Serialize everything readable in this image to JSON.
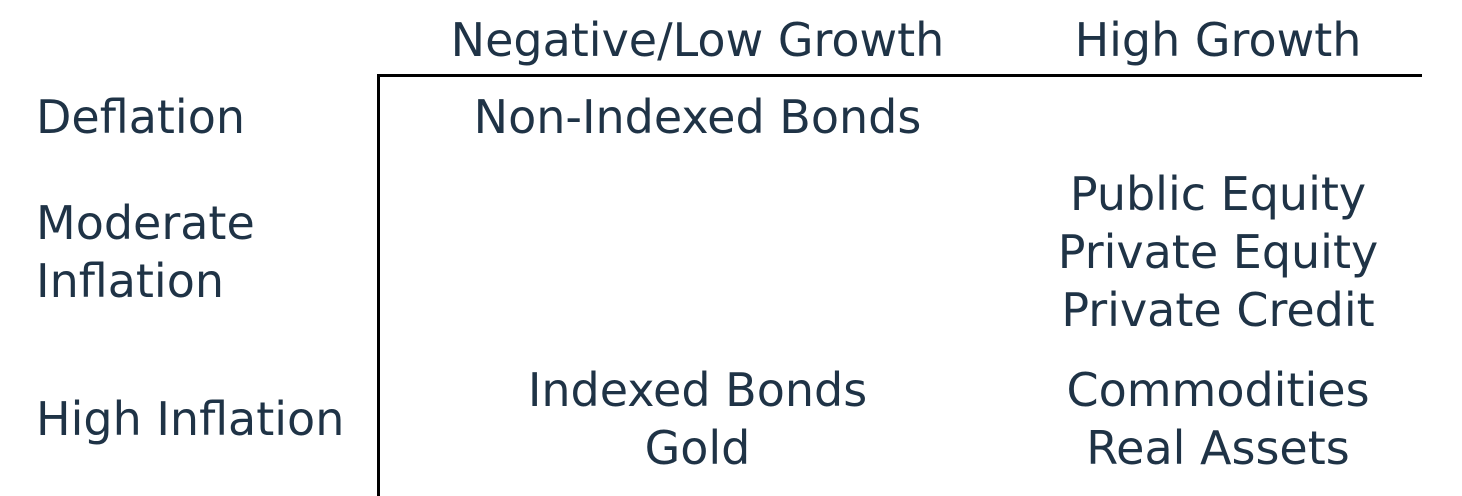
{
  "columns": {
    "low_growth": "Negative/Low Growth",
    "high_growth": "High Growth"
  },
  "rows": {
    "deflation": [
      "Deflation"
    ],
    "moderate_inflation": [
      "Moderate",
      "Inflation"
    ],
    "high_inflation": [
      "High Inflation"
    ]
  },
  "cells": {
    "deflation_low": [
      "Non-Indexed Bonds"
    ],
    "moderate_high": [
      "Public Equity",
      "Private Equity",
      "Private Credit"
    ],
    "high_low": [
      "Indexed Bonds",
      "Gold"
    ],
    "high_high": [
      "Commodities",
      "Real Assets"
    ]
  },
  "colors": {
    "text": "#1f3346",
    "rule": "#000000",
    "background": "#ffffff"
  }
}
